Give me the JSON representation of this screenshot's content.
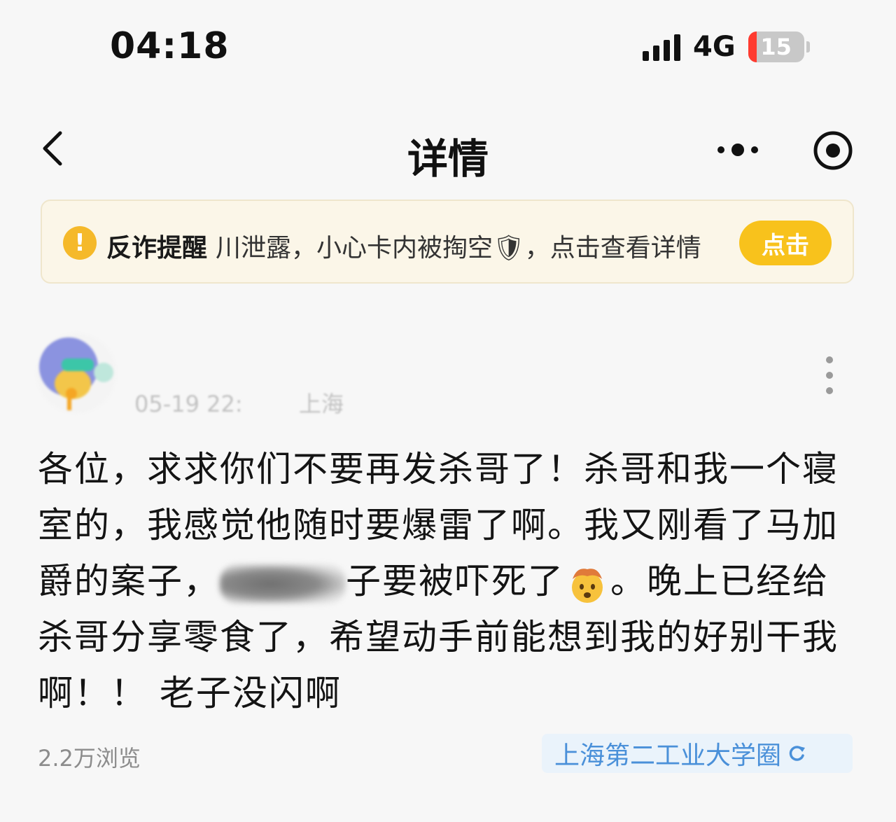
{
  "status_bar": {
    "time": "04:18",
    "network": "4G",
    "battery_level": "15"
  },
  "nav": {
    "title": "详情"
  },
  "banner": {
    "icon_text": "!",
    "title": "反诈提醒",
    "text": "川泄露，小心卡内被掏空🛡，点击查看详情",
    "button_label": "点击"
  },
  "post": {
    "date": "05-19 22:",
    "location": "上海",
    "body_part1": "各位，求求你们不要再发杀哥了！杀哥和我一个寝室的，我感觉他随时要爆雷了啊。我又刚看了马加爵的案子，",
    "body_part2": "子要被吓死了",
    "body_part3": "。晚上已经给杀哥分享零食了，希望动手前能想到我的好别干我啊！！ 老子没闪啊"
  },
  "footer": {
    "views": "2.2万浏览",
    "circle_name": "上海第二工业大学圈"
  },
  "colors": {
    "accent_yellow": "#f8c21c",
    "banner_bg": "#fbf6e8",
    "tag_blue": "#4a90d9",
    "battery_low": "#ff3b30"
  }
}
